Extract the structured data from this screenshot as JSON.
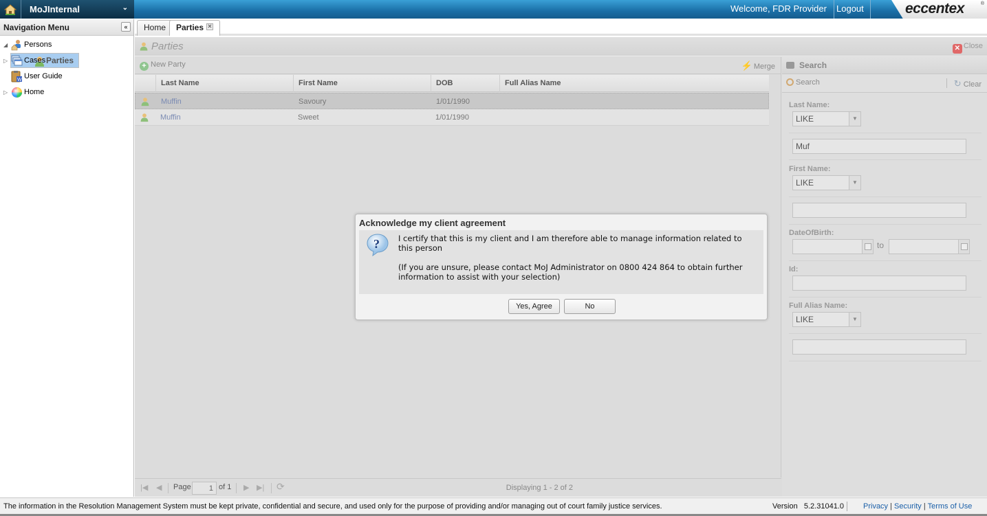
{
  "header": {
    "app_name": "MoJInternal",
    "welcome": "Welcome, FDR Provider",
    "logout": "Logout",
    "brand": "eccentex",
    "brand_mark": "®"
  },
  "nav": {
    "title": "Navigation Menu",
    "collapse_glyph": "«",
    "items": [
      {
        "label": "Persons",
        "icon": "persons-icon",
        "expanded": true
      },
      {
        "label": "Parties",
        "icon": "person-icon",
        "selected": true
      },
      {
        "label": "Cases",
        "icon": "windows-icon",
        "expanded": false
      },
      {
        "label": "User Guide",
        "icon": "document-icon"
      },
      {
        "label": "Home",
        "icon": "color-wheel-icon",
        "expanded": false
      }
    ]
  },
  "tabs": [
    {
      "label": "Home",
      "active": false
    },
    {
      "label": "Parties",
      "active": true,
      "closable": true
    }
  ],
  "panel": {
    "title": "Parties",
    "close": "Close",
    "new_party": "New Party",
    "merge": "Merge"
  },
  "grid": {
    "columns": [
      "",
      "Last Name",
      "First Name",
      "DOB",
      "Full Alias Name"
    ],
    "rows": [
      {
        "last_name": "Muffin",
        "first_name": "Savoury",
        "dob": "1/01/1990",
        "alias": "",
        "selected": true
      },
      {
        "last_name": "Muffin",
        "first_name": "Sweet",
        "dob": "1/01/1990",
        "alias": "",
        "selected": false
      }
    ]
  },
  "pager": {
    "page_label": "Page",
    "page_value": "1",
    "of_label": "of 1",
    "displaying": "Displaying 1 - 2 of 2"
  },
  "search": {
    "title": "Search",
    "search_btn": "Search",
    "clear_btn": "Clear",
    "last_name_label": "Last Name:",
    "last_name_op": "LIKE",
    "last_name_value": "Muf",
    "first_name_label": "First Name:",
    "first_name_op": "LIKE",
    "first_name_value": "",
    "dob_label": "DateOfBirth:",
    "dob_to": "to",
    "id_label": "Id:",
    "alias_label": "Full Alias Name:",
    "alias_op": "LIKE",
    "alias_value": ""
  },
  "modal": {
    "title": "Acknowledge my client agreement",
    "line1": "I certify that this is my client and I am therefore able to manage information related to this person",
    "line2": "(If you are unsure, please contact MoJ Administrator on 0800 424 864 to obtain further information to assist with your selection)",
    "yes": "Yes, Agree",
    "no": "No"
  },
  "footer": {
    "note": "The information in the Resolution Management System must be kept private, confidential and secure, and used only for the purpose of providing and/or managing out of court family justice services.",
    "version_label": "Version",
    "version": "5.2.31041.0",
    "privacy": "Privacy",
    "security": "Security",
    "terms": "Terms of Use",
    "sep": "|"
  }
}
